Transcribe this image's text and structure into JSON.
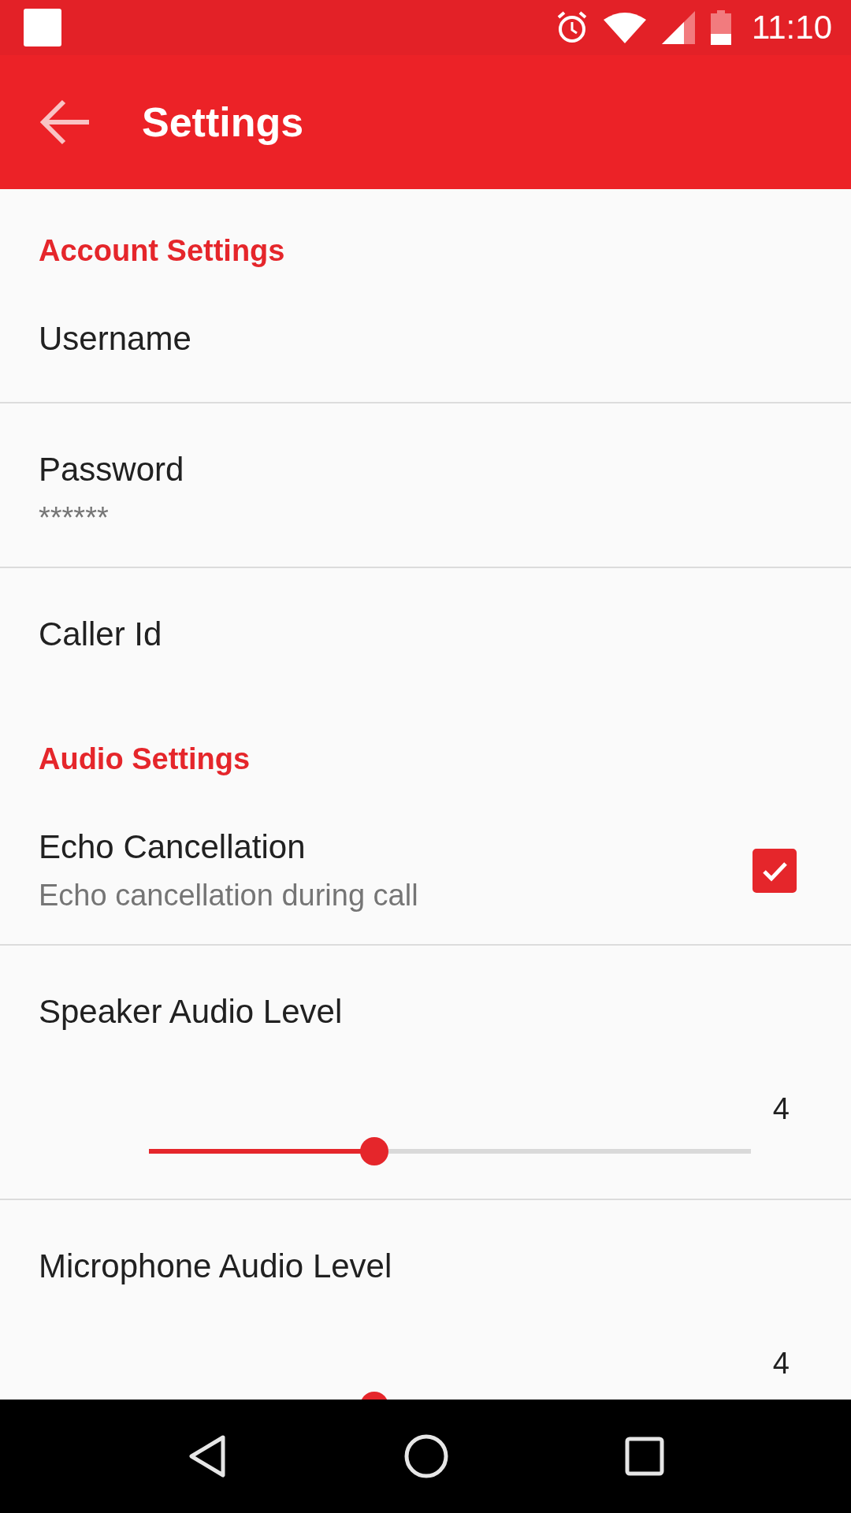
{
  "status_bar": {
    "time": "11:10"
  },
  "app_bar": {
    "title": "Settings"
  },
  "preferences": [
    {
      "kind": "header",
      "title": "Account Settings"
    },
    {
      "kind": "text",
      "title": "Username"
    },
    {
      "kind": "text",
      "title": "Password",
      "summary": "******"
    },
    {
      "kind": "text",
      "title": "Caller Id"
    },
    {
      "kind": "header",
      "title": "Audio Settings"
    },
    {
      "kind": "checkbox",
      "title": "Echo Cancellation",
      "summary": "Echo cancellation during call",
      "checked": true
    },
    {
      "kind": "slider",
      "title": "Speaker Audio Level",
      "value": "4",
      "level": 0.374
    },
    {
      "kind": "slider",
      "title": "Microphone Audio Level",
      "value": "4",
      "level": 0.374
    }
  ]
}
